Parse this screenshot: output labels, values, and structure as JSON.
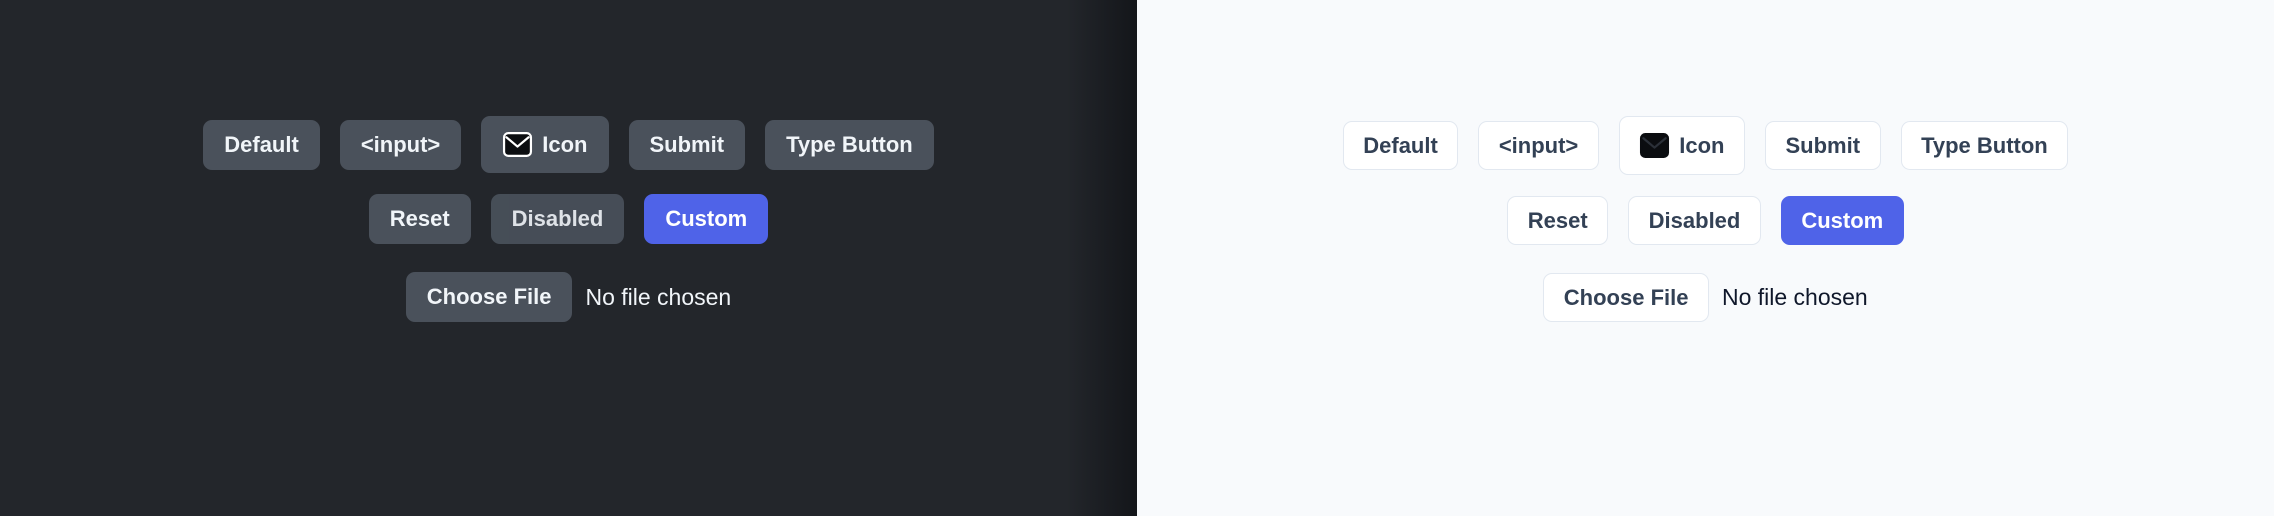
{
  "theme_colors": {
    "dark_background": "#23262b",
    "light_background": "#f8fafc",
    "dark_button_bg": "#4a515b",
    "dark_button_text": "#f1f5f9",
    "light_button_bg": "#ffffff",
    "light_button_border": "#e2e8f0",
    "light_button_text": "#334155",
    "custom_accent": "#4f63e8",
    "custom_accent_text": "#ffffff"
  },
  "panels": [
    {
      "name": "dark",
      "rows": [
        {
          "buttons": [
            {
              "label": "Default",
              "variant": "default",
              "icon": null
            },
            {
              "label": "<input>",
              "variant": "default",
              "icon": null
            },
            {
              "label": "Icon",
              "variant": "default",
              "icon": "envelope-icon"
            },
            {
              "label": "Submit",
              "variant": "default",
              "icon": null
            },
            {
              "label": "Type Button",
              "variant": "default",
              "icon": null
            }
          ]
        },
        {
          "buttons": [
            {
              "label": "Reset",
              "variant": "default",
              "icon": null
            },
            {
              "label": "Disabled",
              "variant": "disabled",
              "icon": null
            },
            {
              "label": "Custom",
              "variant": "custom",
              "icon": null
            }
          ]
        }
      ],
      "file_input": {
        "button_label": "Choose File",
        "file_name": "No file chosen"
      }
    },
    {
      "name": "light",
      "rows": [
        {
          "buttons": [
            {
              "label": "Default",
              "variant": "default",
              "icon": null
            },
            {
              "label": "<input>",
              "variant": "default",
              "icon": null
            },
            {
              "label": "Icon",
              "variant": "default",
              "icon": "envelope-icon"
            },
            {
              "label": "Submit",
              "variant": "default",
              "icon": null
            },
            {
              "label": "Type Button",
              "variant": "default",
              "icon": null
            }
          ]
        },
        {
          "buttons": [
            {
              "label": "Reset",
              "variant": "default",
              "icon": null
            },
            {
              "label": "Disabled",
              "variant": "disabled",
              "icon": null
            },
            {
              "label": "Custom",
              "variant": "custom",
              "icon": null
            }
          ]
        }
      ],
      "file_input": {
        "button_label": "Choose File",
        "file_name": "No file chosen"
      }
    }
  ]
}
